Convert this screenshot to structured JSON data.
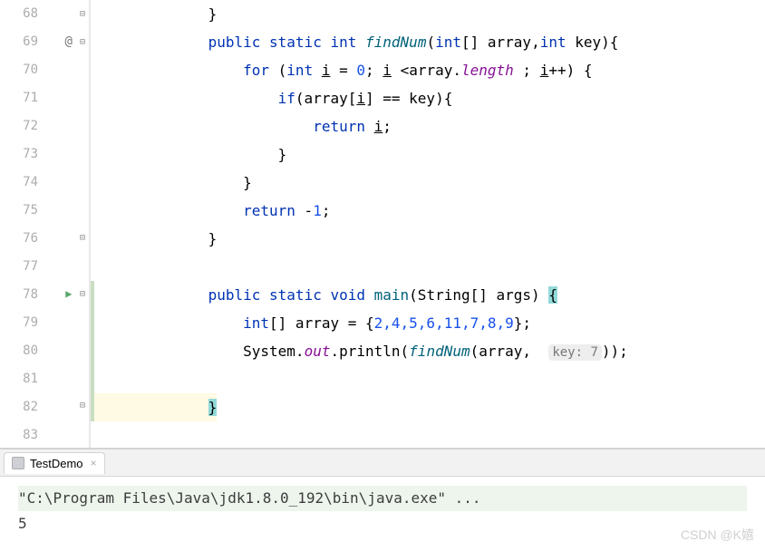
{
  "gutter": {
    "lines": [
      "68",
      "69",
      "70",
      "71",
      "72",
      "73",
      "74",
      "75",
      "76",
      "77",
      "78",
      "79",
      "80",
      "81",
      "82",
      "83"
    ]
  },
  "code": {
    "l68": "            }",
    "l69_k1": "public",
    "l69_k2": "static",
    "l69_t1": "int",
    "l69_m1": "findNum",
    "l69_t2": "int",
    "l69_p1": "[] array,",
    "l69_t3": "int",
    "l69_p2": " key){",
    "l70_k1": "for",
    "l70_t1": "int",
    "l70_v1": "i",
    "l70_eq": " = ",
    "l70_n1": "0",
    "l70_p1": "; ",
    "l70_v2": "i",
    "l70_p2": " <array.",
    "l70_f1": "length",
    "l70_p3": " ; ",
    "l70_v3": "i",
    "l70_p4": "++) {",
    "l71_k1": "if",
    "l71_p1": "(array[",
    "l71_v1": "i",
    "l71_p2": "] == key){",
    "l72_k1": "return",
    "l72_v1": "i",
    "l72_p1": ";",
    "l73": "                    }",
    "l74": "                }",
    "l75_k1": "return",
    "l75_p1": " -",
    "l75_n1": "1",
    "l75_p2": ";",
    "l76": "            }",
    "l77": "",
    "l78_k1": "public",
    "l78_k2": "static",
    "l78_k3": "void",
    "l78_m1": "main",
    "l78_p1": "(String[] args) ",
    "l78_b1": "{",
    "l79_t1": "int",
    "l79_p1": "[] array = {",
    "l79_n": "2,4,5,6,11,7,8,9",
    "l79_p2": "};",
    "l80_p1": "System.",
    "l80_f1": "out",
    "l80_p2": ".println(",
    "l80_m1": "findNum",
    "l80_p3": "(array, ",
    "l80_h1": "key: 7",
    "l80_p4": "));",
    "l81": "",
    "l82": "            ",
    "l82_b": "}",
    "l83": ""
  },
  "tab": {
    "label": "TestDemo",
    "close": "×"
  },
  "console": {
    "cmd": "\"C:\\Program Files\\Java\\jdk1.8.0_192\\bin\\java.exe\" ...",
    "output": "5"
  },
  "watermark": "CSDN @K嬉"
}
